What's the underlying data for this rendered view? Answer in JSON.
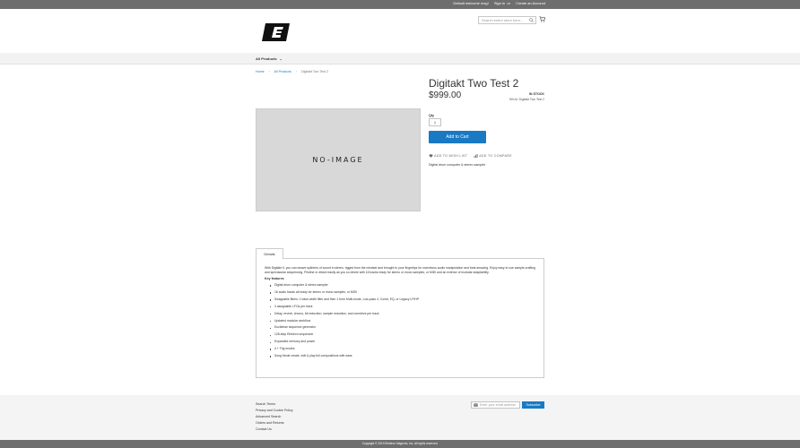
{
  "header": {
    "welcome": "Default welcome msg!",
    "sign_in": "Sign In",
    "or": "or",
    "create_account": "Create an Account",
    "search_placeholder": "Search entire store here..."
  },
  "nav": {
    "all_products": "All Products"
  },
  "breadcrumb": {
    "home": "Home",
    "category": "All Products",
    "current": "Digitakt Two Test 2"
  },
  "product": {
    "title": "Digitakt Two Test 2",
    "price": "$999.00",
    "stock": "IN STOCK",
    "sku_label": "SKU#:",
    "sku_value": "Digitakt Two Test 2",
    "qty_label": "Qty",
    "qty_value": "1",
    "add_to_cart": "Add to Cart",
    "wish_list": "Add to Wish List",
    "compare": "Add to Compare",
    "short_description": "Digital drum computer & stereo sampler",
    "image_placeholder": "NO-IMAGE"
  },
  "details": {
    "tab_label": "Details",
    "intro": "With Digitakt II, you can weave splinters of sound in stereo, rigged from the mindset and brought to your fingertips for marvelous audio manipulation and beat amazing. Enjoy easy to use sample-crafting and spectacular sequencing. Pristine or distort easily as you so desire with 16 tracks ready for stereo or mono samples, or MIDI and an exterior of modular adaptability.",
    "key_features_label": "Key features",
    "features": [
      "Digital drum computer & stereo sampler",
      "16 audio tracks all ready for stereo or mono samples, or MIDI",
      "Swappable filters: 1 base-width filter and then 1 from Multi-mode, Low-pass 4, Comb, EQ, or Legacy LP/HP",
      "3 assignable LFOs per track",
      "Delay, reverb, chorus, bit reduction, sample reduction, and overdrive per track",
      "Updated modular workflow",
      "Euclidean sequence generator",
      "128-step Elektron sequencer",
      "Expanded memory and power",
      "4 + Trig modes",
      "Song Mode create, edit & play full compositions with ease"
    ]
  },
  "footer": {
    "links": [
      "Search Terms",
      "Privacy and Cookie Policy",
      "Advanced Search",
      "Orders and Returns",
      "Contact Us"
    ],
    "newsletter_placeholder": "Enter your email address",
    "subscribe": "Subscribe",
    "copyright": "Copyright © 2019 Elektron Magento, Inc. All rights reserved."
  },
  "colors": {
    "accent": "#1979c3",
    "bar": "#6e6e6e"
  }
}
